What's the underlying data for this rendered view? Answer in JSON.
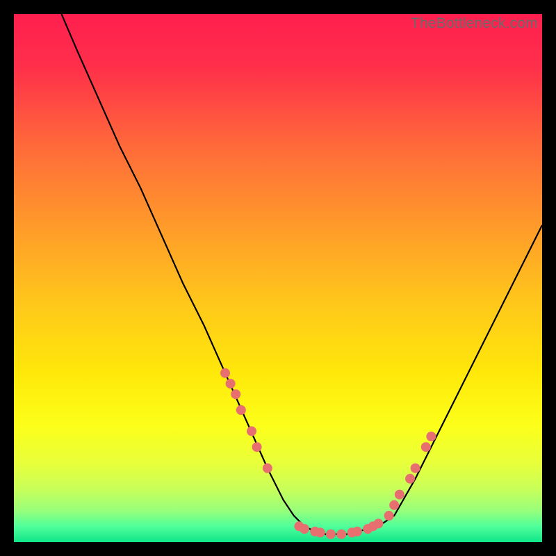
{
  "watermark": "TheBottleneck.com",
  "chart_data": {
    "type": "line",
    "title": "",
    "xlabel": "",
    "ylabel": "",
    "xlim": [
      0,
      100
    ],
    "ylim": [
      0,
      100
    ],
    "grid": false,
    "series": [
      {
        "name": "bottleneck-curve",
        "x": [
          9,
          12,
          16,
          20,
          24,
          28,
          32,
          36,
          40,
          44,
          48,
          51,
          53,
          55,
          57,
          59,
          61,
          63,
          65,
          67,
          69,
          72,
          76,
          80,
          84,
          88,
          92,
          96,
          100
        ],
        "y": [
          100,
          93,
          84,
          75,
          67,
          58,
          49,
          41,
          32,
          23,
          14,
          8,
          5,
          3,
          2,
          1.5,
          1.5,
          1.5,
          2,
          2.5,
          3,
          5,
          12,
          20,
          28,
          36,
          44,
          52,
          60
        ]
      }
    ],
    "markers": {
      "name": "dense-markers",
      "color": "#e76f6f",
      "points": [
        {
          "x": 40,
          "y": 32
        },
        {
          "x": 41,
          "y": 30
        },
        {
          "x": 42,
          "y": 28
        },
        {
          "x": 43,
          "y": 25
        },
        {
          "x": 45,
          "y": 21
        },
        {
          "x": 46,
          "y": 18
        },
        {
          "x": 48,
          "y": 14
        },
        {
          "x": 54,
          "y": 3
        },
        {
          "x": 55,
          "y": 2.5
        },
        {
          "x": 57,
          "y": 2
        },
        {
          "x": 58,
          "y": 1.8
        },
        {
          "x": 60,
          "y": 1.5
        },
        {
          "x": 62,
          "y": 1.5
        },
        {
          "x": 64,
          "y": 1.8
        },
        {
          "x": 65,
          "y": 2
        },
        {
          "x": 67,
          "y": 2.5
        },
        {
          "x": 68,
          "y": 3
        },
        {
          "x": 69,
          "y": 3.5
        },
        {
          "x": 71,
          "y": 5
        },
        {
          "x": 72,
          "y": 7
        },
        {
          "x": 73,
          "y": 9
        },
        {
          "x": 75,
          "y": 12
        },
        {
          "x": 76,
          "y": 14
        },
        {
          "x": 78,
          "y": 18
        },
        {
          "x": 79,
          "y": 20
        }
      ]
    },
    "background_gradient": {
      "stops": [
        {
          "offset": 0.0,
          "color": "#ff1f4f"
        },
        {
          "offset": 0.1,
          "color": "#ff2f4a"
        },
        {
          "offset": 0.25,
          "color": "#ff6a3a"
        },
        {
          "offset": 0.4,
          "color": "#ff9a2a"
        },
        {
          "offset": 0.55,
          "color": "#ffc81a"
        },
        {
          "offset": 0.68,
          "color": "#ffe80a"
        },
        {
          "offset": 0.78,
          "color": "#fcff1a"
        },
        {
          "offset": 0.85,
          "color": "#e8ff3a"
        },
        {
          "offset": 0.9,
          "color": "#c8ff5a"
        },
        {
          "offset": 0.94,
          "color": "#98ff7a"
        },
        {
          "offset": 0.97,
          "color": "#50ff9a"
        },
        {
          "offset": 1.0,
          "color": "#10e58a"
        }
      ]
    }
  }
}
